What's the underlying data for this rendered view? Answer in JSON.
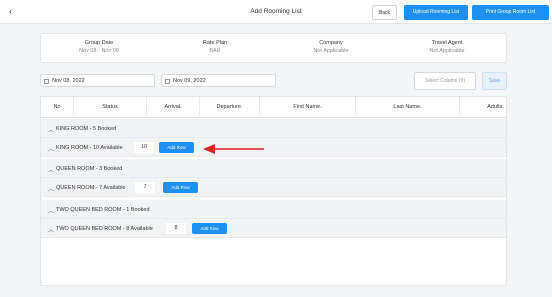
{
  "header": {
    "back_glyph": "‹",
    "title": "Add Rooming List",
    "back_button": "Back",
    "upload_button": "Upload Rooming List",
    "print_button": "Print Group Room List"
  },
  "info": {
    "group_date_label": "Group Date",
    "group_date_value": "Nov 08 - Nov 09",
    "rate_plan_label": "Rate Plan",
    "rate_plan_value": "BAR",
    "company_label": "Company",
    "company_value": "Not Applicable",
    "travel_agent_label": "Travel Agent",
    "travel_agent_value": "Not Applicable"
  },
  "dates": {
    "start": "Nov 08, 2022",
    "end": "Nov 09, 2022"
  },
  "toolbar": {
    "select_column": "Select Column (9)",
    "save": "Save"
  },
  "table": {
    "columns": [
      {
        "label": "No",
        "required": ""
      },
      {
        "label": "Status",
        "required": ""
      },
      {
        "label": "Arrival",
        "required": "*"
      },
      {
        "label": "Departure",
        "required": "*"
      },
      {
        "label": "First Name",
        "required": "*"
      },
      {
        "label": "Last Name",
        "required": "*"
      },
      {
        "label": "Adults",
        "required": "*"
      }
    ],
    "groups": [
      {
        "name": "KING ROOM - 5 Booked"
      },
      {
        "name": "KING ROOM - 10 Available",
        "count": "10",
        "add_row": "Add Row"
      },
      {
        "name": "QUEEN ROOM - 3 Booked"
      },
      {
        "name": "QUEEN ROOM - 7 Available",
        "count": "7",
        "add_row": "Add Row"
      },
      {
        "name": "TWO QUEEN BED ROOM - 1 Booked"
      },
      {
        "name": "TWO QUEEN BED ROOM - 8 Available",
        "count": "8",
        "add_row": "Add Row"
      }
    ]
  },
  "colors": {
    "primary": "#1e90f2",
    "annotation_arrow": "#e02020"
  }
}
